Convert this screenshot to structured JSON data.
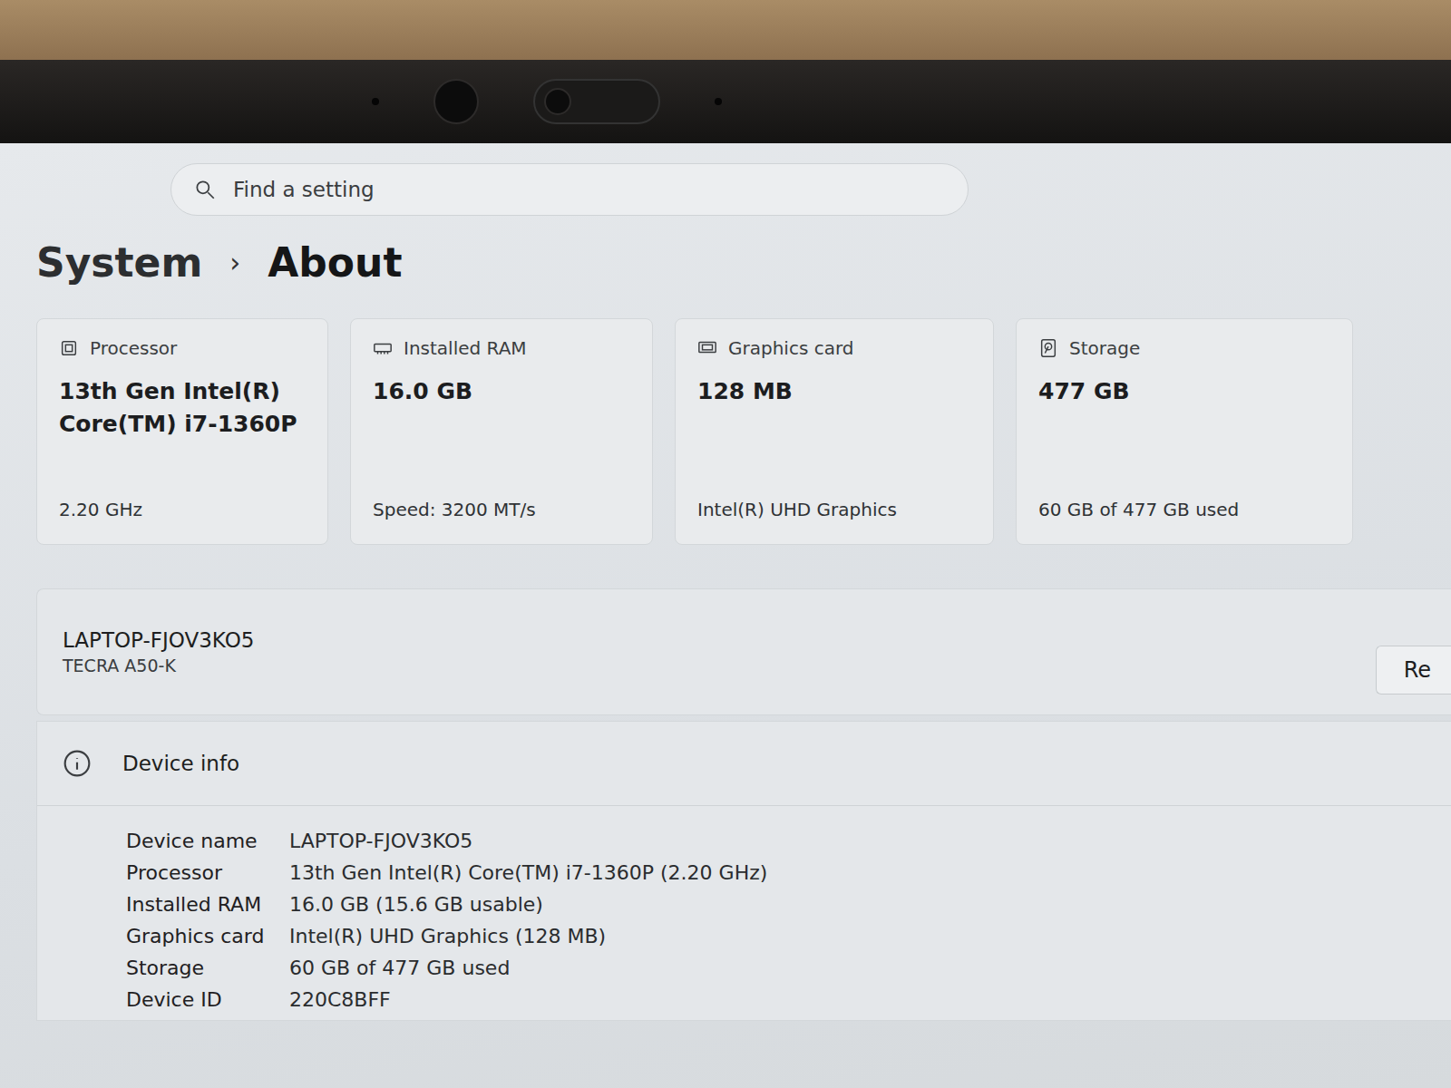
{
  "window": {
    "title": "About",
    "breadcrumb": [
      "System",
      "›",
      "About"
    ]
  },
  "search": {
    "placeholder": "Find a setting"
  },
  "spec_cards": [
    {
      "label": "Processor",
      "value": "13th Gen Intel(R) Core(TM) i7-1360P",
      "detail": "2.20 GHz",
      "kind": "cpu"
    },
    {
      "label": "Installed RAM",
      "value": "16.0 GB",
      "detail": "Speed: 3200 MT/s",
      "kind": "ram"
    },
    {
      "label": "Graphics card",
      "value": "128 MB",
      "detail": "Intel(R) UHD Graphics",
      "kind": "gpu"
    },
    {
      "label": "Storage",
      "value": "477 GB",
      "detail": "60 GB of 477 GB used",
      "kind": "storage"
    }
  ],
  "device": {
    "name": "LAPTOP-FJOV3KO5",
    "model": "TECRA A50-K",
    "button": "Re"
  },
  "device_info": {
    "title": "Device info",
    "rows": [
      {
        "label": "Device name",
        "value": "LAPTOP-FJOV3KO5"
      },
      {
        "label": "Processor",
        "value": "13th Gen Intel(R) Core(TM) i7-1360P (2.20 GHz)"
      },
      {
        "label": "Installed RAM",
        "value": "16.0 GB (15.6 GB usable)"
      },
      {
        "label": "Graphics card",
        "value": "Intel(R) UHD Graphics (128 MB)"
      },
      {
        "label": "Storage",
        "value": "60 GB of 477 GB used"
      },
      {
        "label": "Device ID",
        "value": "220C8BFF"
      }
    ]
  }
}
